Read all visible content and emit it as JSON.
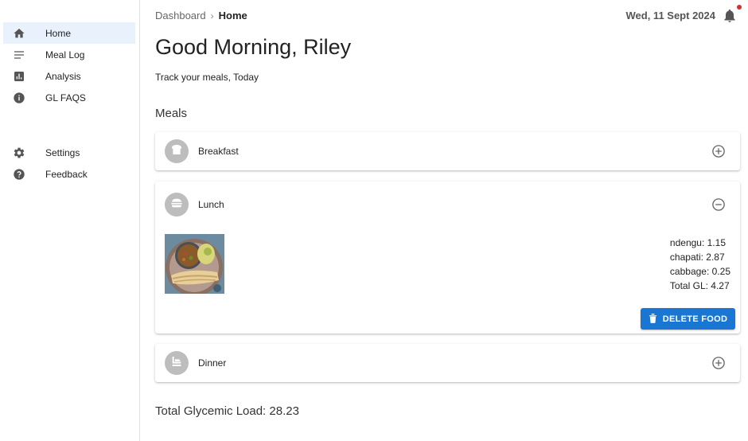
{
  "sidebar": {
    "primary": [
      {
        "label": "Home",
        "icon": "home-icon",
        "active": true
      },
      {
        "label": "Meal Log",
        "icon": "list-icon"
      },
      {
        "label": "Analysis",
        "icon": "chart-icon"
      },
      {
        "label": "GL FAQS",
        "icon": "info-icon"
      }
    ],
    "secondary": [
      {
        "label": "Settings",
        "icon": "gear-icon"
      },
      {
        "label": "Feedback",
        "icon": "help-icon"
      }
    ]
  },
  "header": {
    "breadcrumb": {
      "parent": "Dashboard",
      "separator": "›",
      "current": "Home"
    },
    "date": "Wed, 11 Sept 2024"
  },
  "greeting": "Good Morning, Riley",
  "subtitle": "Track your meals, Today",
  "meals_title": "Meals",
  "meals": {
    "breakfast": {
      "name": "Breakfast",
      "expanded": false
    },
    "lunch": {
      "name": "Lunch",
      "expanded": true,
      "gl_items": [
        "ndengu: 1.15",
        "chapati: 2.87",
        "cabbage: 0.25",
        "Total GL: 4.27"
      ],
      "delete_label": "DELETE FOOD"
    },
    "dinner": {
      "name": "Dinner",
      "expanded": false
    }
  },
  "total_gl": "Total Glycemic Load: 28.23",
  "colors": {
    "accent": "#1976d2",
    "active_nav": "#e9f2fc",
    "notification": "#d32f2f",
    "avatar": "#bdbdbd"
  }
}
